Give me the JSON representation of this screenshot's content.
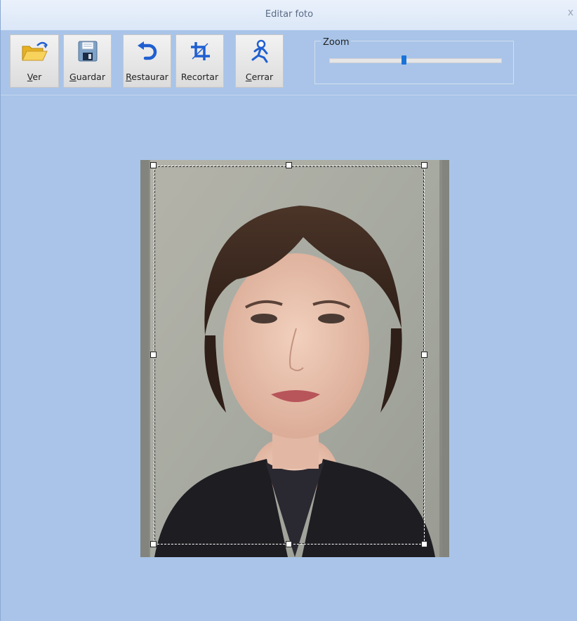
{
  "window": {
    "title": "Editar foto",
    "close_label": "x"
  },
  "toolbar": {
    "buttons": [
      {
        "id": "ver",
        "accel": "V",
        "rest": "er",
        "icon": "open-folder-icon"
      },
      {
        "id": "guardar",
        "accel": "G",
        "rest": "uardar",
        "icon": "floppy-disk-icon"
      },
      {
        "id": "restaurar",
        "accel": "R",
        "rest": "estaurar",
        "icon": "undo-arrow-icon"
      },
      {
        "id": "recortar",
        "accel": "",
        "rest": "Recortar",
        "icon": "crop-icon"
      },
      {
        "id": "cerrar",
        "accel": "C",
        "rest": "errar",
        "icon": "exit-runner-icon"
      }
    ]
  },
  "zoom": {
    "label": "Zoom",
    "value_fraction": 0.43
  },
  "colors": {
    "background": "#a9c4e8",
    "slider_thumb": "#1a73d9",
    "icon_blue": "#1f5fd1",
    "folder_yellow": "#f2c53d"
  }
}
